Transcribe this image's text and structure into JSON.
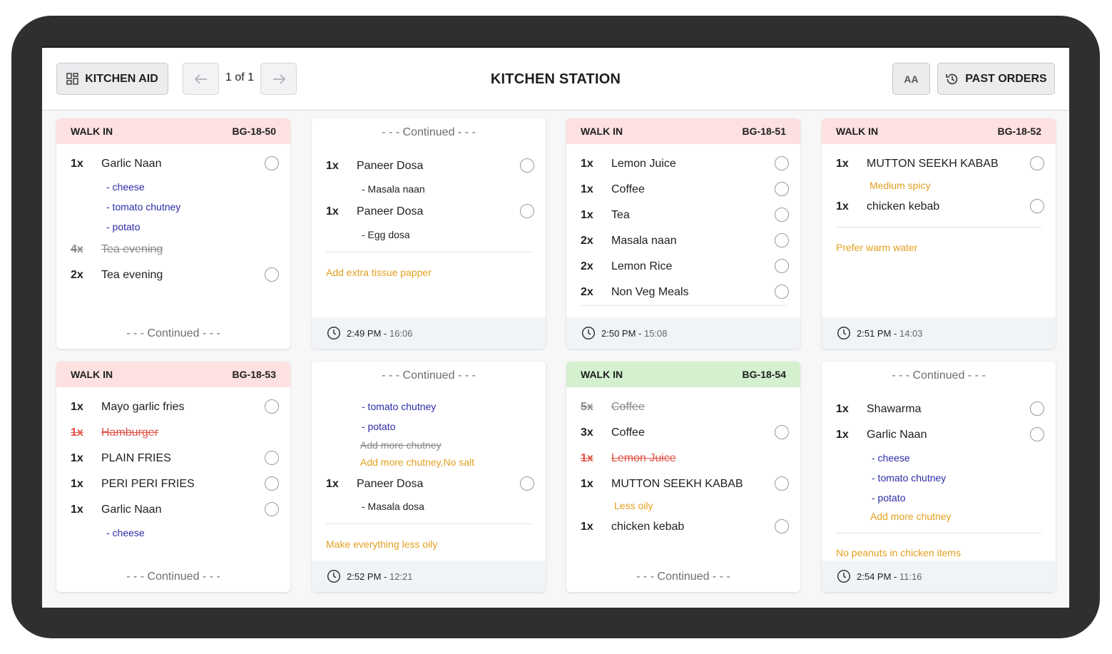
{
  "header": {
    "kitchen_aid_label": "KITCHEN AID",
    "page_indicator": "1 of 1",
    "title": "KITCHEN STATION",
    "font_size_label": "AA",
    "past_orders_label": "PAST ORDERS"
  },
  "continued_text": "- - - Continued - - -",
  "colors": {
    "modifier": "#2c2ca8",
    "note": "#e3a020",
    "void": "#e05045",
    "header_pink": "#fde0e0",
    "header_green": "#d4f0cf"
  },
  "cards": [
    {
      "type": "WALK IN",
      "order": "BG-18-50",
      "items": [
        {
          "qty": "1x",
          "name": "Garlic Naan"
        },
        {
          "qty": "4x",
          "name": "Tea evening"
        },
        {
          "qty": "2x",
          "name": "Tea evening"
        }
      ],
      "modifiers": [
        "- cheese",
        "- tomato chutney",
        "- potato"
      ]
    },
    {
      "items": [
        {
          "qty": "1x",
          "name": "Paneer Dosa",
          "sub": "- Masala naan"
        },
        {
          "qty": "1x",
          "name": "Paneer Dosa",
          "sub": "- Egg dosa"
        }
      ],
      "note": "Add extra tissue papper",
      "time": "2:49 PM - ",
      "elapsed": "16:06"
    },
    {
      "type": "WALK IN",
      "order": "BG-18-51",
      "items": [
        {
          "qty": "1x",
          "name": "Lemon Juice"
        },
        {
          "qty": "1x",
          "name": "Coffee"
        },
        {
          "qty": "1x",
          "name": "Tea"
        },
        {
          "qty": "2x",
          "name": "Masala naan"
        },
        {
          "qty": "2x",
          "name": "Lemon Rice"
        },
        {
          "qty": "2x",
          "name": "Non Veg Meals"
        }
      ],
      "time": "2:50 PM - ",
      "elapsed": "15:08"
    },
    {
      "type": "WALK IN",
      "order": "BG-18-52",
      "items": [
        {
          "qty": "1x",
          "name": "MUTTON SEEKH KABAB",
          "note": "Medium spicy"
        },
        {
          "qty": "1x",
          "name": "chicken kebab"
        }
      ],
      "note": "Prefer warm water",
      "time": "2:51 PM - ",
      "elapsed": "14:03"
    },
    {
      "type": "WALK IN",
      "order": "BG-18-53",
      "items": [
        {
          "qty": "1x",
          "name": "Mayo garlic fries"
        },
        {
          "qty": "1x",
          "name": "Hamburger"
        },
        {
          "qty": "1x",
          "name": "PLAIN FRIES"
        },
        {
          "qty": "1x",
          "name": "PERI PERI FRIES"
        },
        {
          "qty": "1x",
          "name": "Garlic Naan"
        }
      ],
      "modifiers": [
        "- cheese"
      ]
    },
    {
      "modifiers": [
        "- tomato chutney",
        "- potato"
      ],
      "struck_note": "Add more chutney",
      "item_note": "Add more chutney,No salt",
      "items": [
        {
          "qty": "1x",
          "name": "Paneer Dosa",
          "sub": "- Masala dosa"
        }
      ],
      "note": "Make everything less oily",
      "time": "2:52 PM - ",
      "elapsed": "12:21"
    },
    {
      "type": "WALK IN",
      "order": "BG-18-54",
      "items": [
        {
          "qty": "5x",
          "name": "Coffee"
        },
        {
          "qty": "3x",
          "name": "Coffee"
        },
        {
          "qty": "1x",
          "name": "Lemon Juice"
        },
        {
          "qty": "1x",
          "name": "MUTTON SEEKH KABAB",
          "note": "Less oily"
        },
        {
          "qty": "1x",
          "name": "chicken kebab"
        }
      ]
    },
    {
      "items": [
        {
          "qty": "1x",
          "name": "Shawarma"
        },
        {
          "qty": "1x",
          "name": "Garlic Naan"
        }
      ],
      "modifiers": [
        "- cheese",
        "- tomato chutney",
        "- potato"
      ],
      "item_note": "Add more chutney",
      "note": "No peanuts in chicken items",
      "time": "2:54 PM - ",
      "elapsed": "11:16"
    }
  ]
}
